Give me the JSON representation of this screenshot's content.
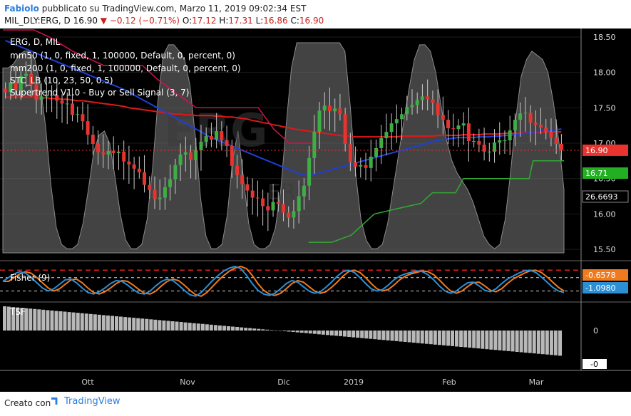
{
  "header": {
    "author": "Fabiolo",
    "published_text": "pubblicato su TradingView.com, Marzo 11, 2019 09:02:34 EST",
    "symbol": "MIL_DLY:ERG, D",
    "last": "16.90",
    "change": "−0.12 (−0.71%)",
    "o_label": "O:",
    "o_val": "17.12",
    "h_label": "H:",
    "h_val": "17.31",
    "l_label": "L:",
    "l_val": "16.86",
    "c_label": "C:",
    "c_val": "16.90"
  },
  "legend": {
    "title": "ERG, D, MIL",
    "watermark": "ERG",
    "watermark_sub": "ERG",
    "items": [
      "mm50 (1, 0, fixed, 1, 100000, Default, 0, percent, 0)",
      "mm200 (1, 0, fixed, 1, 100000, Default, 0, percent, 0)",
      "STC_LB (10, 23, 50, 0.5)",
      "Supertrend V1.0 - Buy or Sell Signal (3, 7)"
    ]
  },
  "fisher": {
    "title": "Fisher (9)",
    "value1": "-0.6578",
    "value2": "-1.0980"
  },
  "tsf": {
    "title": "TSF",
    "zero_label": "0",
    "last_label": "-0"
  },
  "footer": {
    "created_with": "Creato con",
    "brand": "TradingView"
  },
  "colors": {
    "up": "#3dae45",
    "down": "#e8332e",
    "ma50": "#1f3fd6",
    "ma200": "#e01818",
    "supertrend_up": "#33a833",
    "supertrend_down": "#d4114a",
    "stc": "#8a8a8a",
    "fisher": "#2b8fd6",
    "fisher_trigger": "#f07a1e",
    "fisher_level": "#e02020"
  },
  "chart_data": {
    "type": "candlestick",
    "ylim": [
      15.4,
      18.6
    ],
    "y_ticks": [
      "18.50",
      "18.00",
      "17.50",
      "17.00",
      "16.50",
      "16.00",
      "15.50"
    ],
    "x_labels": [
      "Ott",
      "Nov",
      "Dic",
      "2019",
      "Feb",
      "Mar"
    ],
    "price_labels": [
      {
        "name": "last",
        "value": 16.9,
        "text": "16.90"
      },
      {
        "name": "supertrend",
        "value": 16.71,
        "text": "16.71"
      },
      {
        "name": "level",
        "value": 16.6693,
        "text": "26.6693"
      }
    ],
    "closes": [
      17.72,
      17.86,
      17.75,
      17.95,
      17.98,
      17.83,
      17.61,
      17.66,
      17.68,
      17.68,
      17.6,
      17.56,
      17.56,
      17.4,
      17.41,
      17.31,
      17.12,
      16.99,
      16.87,
      16.84,
      16.89,
      16.86,
      16.88,
      16.74,
      16.7,
      16.64,
      16.59,
      16.41,
      16.34,
      16.21,
      16.23,
      16.38,
      16.49,
      16.69,
      16.84,
      16.87,
      16.76,
      16.9,
      17.02,
      17.1,
      17.05,
      17.17,
      17.04,
      16.96,
      16.68,
      16.55,
      16.42,
      16.33,
      16.23,
      16.22,
      16.11,
      16.05,
      16.17,
      16.14,
      16.02,
      15.95,
      16.04,
      16.25,
      16.4,
      16.79,
      17.16,
      17.46,
      17.53,
      17.45,
      17.49,
      17.41,
      16.99,
      16.73,
      16.67,
      16.69,
      16.65,
      16.81,
      16.93,
      17.07,
      17.16,
      17.28,
      17.34,
      17.41,
      17.51,
      17.54,
      17.61,
      17.66,
      17.62,
      17.57,
      17.4,
      17.33,
      17.21,
      17.2,
      17.25,
      17.28,
      17.03,
      17.03,
      16.98,
      16.88,
      16.88,
      17.01,
      17.04,
      17.04,
      17.18,
      17.33,
      17.42,
      17.43,
      17.29,
      17.26,
      17.22,
      17.16,
      17.08,
      16.99,
      16.9
    ],
    "ma50": [
      18.45,
      18.42,
      18.39,
      18.36,
      18.33,
      18.3,
      18.27,
      18.24,
      18.21,
      18.18,
      18.15,
      18.12,
      18.09,
      18.06,
      18.03,
      18.0,
      17.97,
      17.94,
      17.91,
      17.88,
      17.85,
      17.82,
      17.79,
      17.76,
      17.72,
      17.68,
      17.64,
      17.6,
      17.56,
      17.52,
      17.48,
      17.44,
      17.4,
      17.36,
      17.32,
      17.28,
      17.24,
      17.2,
      17.16,
      17.12,
      17.08,
      17.05,
      17.02,
      16.99,
      16.96,
      16.93,
      16.9,
      16.87,
      16.84,
      16.81,
      16.78,
      16.75,
      16.72,
      16.69,
      16.66,
      16.63,
      16.6,
      16.57,
      16.55,
      16.54,
      16.56,
      16.58,
      16.6,
      16.62,
      16.64,
      16.66,
      16.68,
      16.7,
      16.72,
      16.74,
      16.76,
      16.78,
      16.8,
      16.82,
      16.84,
      16.86,
      16.88,
      16.9,
      16.92,
      16.94,
      16.96,
      16.98,
      17.0,
      17.02,
      17.04,
      17.05,
      17.06,
      17.07,
      17.08,
      17.08,
      17.08,
      17.08,
      17.09,
      17.09,
      17.09,
      17.1,
      17.1,
      17.11,
      17.11,
      17.12,
      17.13,
      17.14,
      17.15,
      17.16,
      17.17,
      17.18,
      17.18,
      17.19,
      17.2
    ],
    "ma200": [
      17.65,
      17.65,
      17.65,
      17.65,
      17.65,
      17.65,
      17.65,
      17.64,
      17.64,
      17.63,
      17.63,
      17.62,
      17.62,
      17.61,
      17.6,
      17.6,
      17.59,
      17.58,
      17.57,
      17.56,
      17.55,
      17.54,
      17.53,
      17.52,
      17.5,
      17.49,
      17.48,
      17.47,
      17.46,
      17.45,
      17.44,
      17.43,
      17.42,
      17.41,
      17.41,
      17.4,
      17.4,
      17.39,
      17.39,
      17.39,
      17.39,
      17.38,
      17.38,
      17.37,
      17.37,
      17.36,
      17.35,
      17.34,
      17.32,
      17.31,
      17.29,
      17.28,
      17.26,
      17.25,
      17.23,
      17.22,
      17.2,
      17.19,
      17.18,
      17.17,
      17.16,
      17.15,
      17.14,
      17.13,
      17.12,
      17.11,
      17.1,
      17.1,
      17.09,
      17.09,
      17.09,
      17.09,
      17.09,
      17.09,
      17.09,
      17.09,
      17.09,
      17.1,
      17.1,
      17.1,
      17.1,
      17.1,
      17.1,
      17.1,
      17.11,
      17.11,
      17.11,
      17.11,
      17.11,
      17.12,
      17.12,
      17.12,
      17.12,
      17.13,
      17.13,
      17.13,
      17.13,
      17.14,
      17.14,
      17.14,
      17.14,
      17.15,
      17.15,
      17.15,
      17.15,
      17.16,
      17.16,
      17.16,
      17.16
    ],
    "supertrend_down": [
      [
        0,
        18.6
      ],
      [
        8,
        18.6
      ],
      [
        12,
        18.5
      ],
      [
        18,
        18.3
      ],
      [
        22,
        18.2
      ],
      [
        26,
        18.1
      ],
      [
        36,
        18.1
      ],
      [
        40,
        17.9
      ],
      [
        50,
        17.5
      ],
      [
        66,
        17.5
      ],
      [
        70,
        17.2
      ],
      [
        74,
        17.0
      ],
      [
        80,
        17.0
      ]
    ],
    "supertrend_up": [
      [
        79,
        15.6
      ],
      [
        85,
        15.6
      ],
      [
        90,
        15.7
      ],
      [
        94,
        15.9
      ],
      [
        96,
        16.0
      ],
      [
        100,
        16.05
      ],
      [
        104,
        16.1
      ],
      [
        108,
        16.15
      ],
      [
        111,
        16.3
      ],
      [
        117,
        16.3
      ],
      [
        119,
        16.5
      ],
      [
        136,
        16.5
      ],
      [
        137,
        16.75
      ],
      [
        145,
        16.75
      ]
    ],
    "stc": [
      88,
      88,
      90,
      94,
      96,
      96,
      92,
      80,
      60,
      32,
      12,
      4,
      2,
      2,
      4,
      14,
      30,
      48,
      56,
      58,
      52,
      36,
      18,
      6,
      2,
      2,
      4,
      16,
      40,
      72,
      94,
      99,
      99,
      96,
      92,
      80,
      56,
      26,
      8,
      2,
      2,
      4,
      18,
      44,
      58,
      36,
      14,
      4,
      2,
      2,
      4,
      12,
      30,
      60,
      88,
      100,
      100,
      100,
      100,
      100,
      100,
      100,
      100,
      100,
      96,
      70,
      38,
      16,
      6,
      2,
      2,
      4,
      14,
      30,
      46,
      62,
      78,
      92,
      99,
      99,
      96,
      86,
      70,
      54,
      44,
      38,
      34,
      30,
      24,
      16,
      8,
      4,
      2,
      4,
      16,
      38,
      64,
      84,
      92,
      96,
      94,
      92,
      86,
      72,
      54,
      30
    ],
    "fisher": [
      0.4,
      0.9,
      1.4,
      1.7,
      1.5,
      0.9,
      0.2,
      -0.5,
      -0.9,
      -0.6,
      0.0,
      0.6,
      0.7,
      0.2,
      -0.5,
      -1.1,
      -1.3,
      -1.0,
      -0.5,
      0.1,
      0.5,
      0.4,
      -0.1,
      -0.7,
      -1.2,
      -1.3,
      -0.9,
      -0.2,
      0.4,
      0.7,
      0.5,
      -0.1,
      -0.8,
      -1.4,
      -1.6,
      -1.1,
      -0.3,
      0.5,
      1.2,
      1.8,
      2.2,
      2.4,
      2.1,
      1.2,
      0.1,
      -0.8,
      -1.3,
      -1.5,
      -1.2,
      -0.6,
      0.1,
      0.5,
      0.3,
      -0.3,
      -0.9,
      -1.2,
      -1.0,
      -0.4,
      0.3,
      1.1,
      1.7,
      1.9,
      1.6,
      0.9,
      0.1,
      -0.6,
      -0.9,
      -0.7,
      -0.1,
      0.6,
      1.1,
      1.4,
      1.6,
      1.8,
      1.7,
      1.3,
      0.6,
      -0.2,
      -0.9,
      -1.2,
      -0.9,
      -0.3,
      0.2,
      0.3,
      -0.2,
      -0.8,
      -1.0,
      -0.6,
      0.1,
      0.7,
      1.1,
      1.5,
      1.8,
      1.9,
      1.6,
      1.0,
      0.3,
      -0.4,
      -0.9,
      -1.1
    ],
    "fisher_levels": {
      "upper": 1.9,
      "mid_upper": 0.9,
      "mid_lower": -0.9,
      "lower": -1.2
    },
    "tsf_start": 2.5,
    "tsf_end": -2.6
  }
}
